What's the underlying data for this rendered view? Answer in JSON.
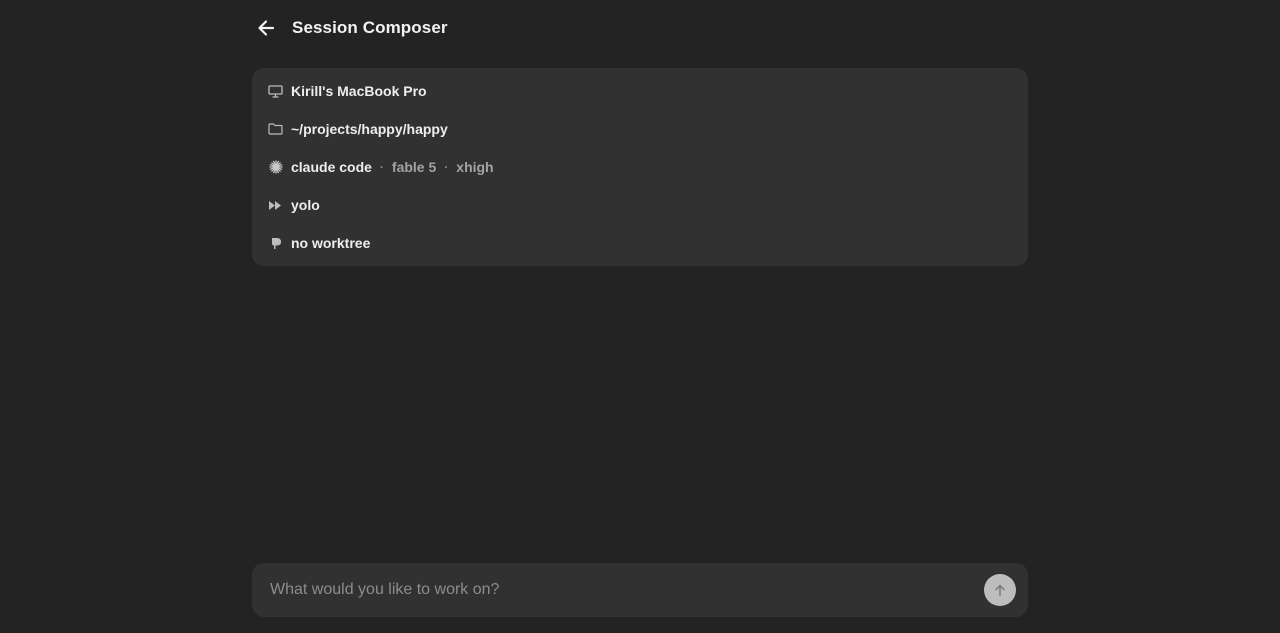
{
  "header": {
    "title": "Session Composer",
    "back_icon": "arrow-left-icon"
  },
  "session": {
    "machine": {
      "icon": "monitor-icon",
      "label": "Kirill's MacBook Pro"
    },
    "path": {
      "icon": "folder-icon",
      "label": "~/projects/happy/happy"
    },
    "agent": {
      "icon": "sparkle-icon",
      "label": "claude code",
      "separator": "·",
      "model": "fable 5",
      "effort": "xhigh"
    },
    "mode": {
      "icon": "fast-forward-icon",
      "label": "yolo"
    },
    "worktree": {
      "icon": "branch-icon",
      "label": "no worktree"
    }
  },
  "composer": {
    "placeholder": "What would you like to work on?",
    "value": "",
    "send_icon": "arrow-up-icon"
  },
  "colors": {
    "background": "#232323",
    "card": "#313131",
    "text": "#ededed",
    "muted": "#a3a3a3",
    "send_button": "#bdbdbd"
  }
}
